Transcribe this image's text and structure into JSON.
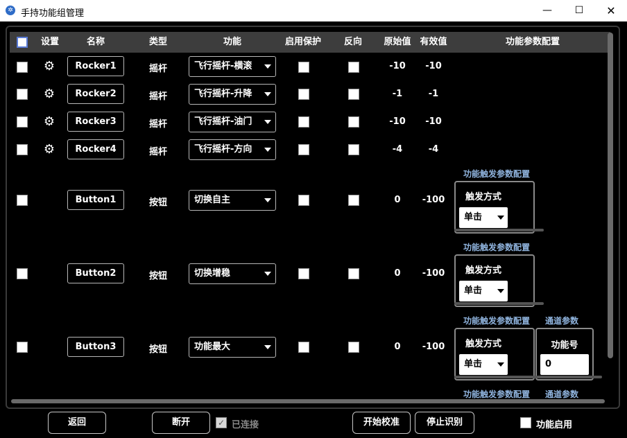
{
  "window": {
    "title": "手持功能组管理",
    "icon": "app-logo-icon",
    "controls": {
      "minimize": "—",
      "maximize": "☐",
      "close": "✕"
    }
  },
  "table": {
    "headers": {
      "settings": "设置",
      "name": "名称",
      "type": "类型",
      "function": "功能",
      "protect": "启用保护",
      "reverse": "反向",
      "raw": "原始值",
      "effective": "有效值",
      "param_config": "功能参数配置"
    },
    "rows": [
      {
        "name": "Rocker1",
        "type": "摇杆",
        "function": "飞行摇杆-横滚",
        "raw": "-10",
        "effective": "-10"
      },
      {
        "name": "Rocker2",
        "type": "摇杆",
        "function": "飞行摇杆-升降",
        "raw": "-1",
        "effective": "-1"
      },
      {
        "name": "Rocker3",
        "type": "摇杆",
        "function": "飞行摇杆-油门",
        "raw": "-10",
        "effective": "-10"
      },
      {
        "name": "Rocker4",
        "type": "摇杆",
        "function": "飞行摇杆-方向",
        "raw": "-4",
        "effective": "-4"
      },
      {
        "name": "Button1",
        "type": "按钮",
        "function": "切换自主",
        "raw": "0",
        "effective": "-100",
        "trigger_config_label": "功能触发参数配置",
        "trigger_mode_label": "触发方式",
        "trigger_mode": "单击"
      },
      {
        "name": "Button2",
        "type": "按钮",
        "function": "切换增稳",
        "raw": "0",
        "effective": "-100",
        "trigger_config_label": "功能触发参数配置",
        "trigger_mode_label": "触发方式",
        "trigger_mode": "单击"
      },
      {
        "name": "Button3",
        "type": "按钮",
        "function": "功能最大",
        "raw": "0",
        "effective": "-100",
        "trigger_config_label": "功能触发参数配置",
        "trigger_mode_label": "触发方式",
        "trigger_mode": "单击",
        "channel_label": "通道参数",
        "function_no_label": "功能号",
        "function_no": "0"
      },
      {
        "trigger_config_label": "功能触发参数配置",
        "channel_label": "通道参数"
      }
    ]
  },
  "footer": {
    "back": "返回",
    "disconnect": "断开",
    "connected_status": "已连接",
    "start_calibration": "开始校准",
    "stop_recognition": "停止识别",
    "function_enable": "功能启用"
  },
  "icons": {
    "settings": "gear-icon",
    "dropdown": "chevron-down-icon"
  }
}
